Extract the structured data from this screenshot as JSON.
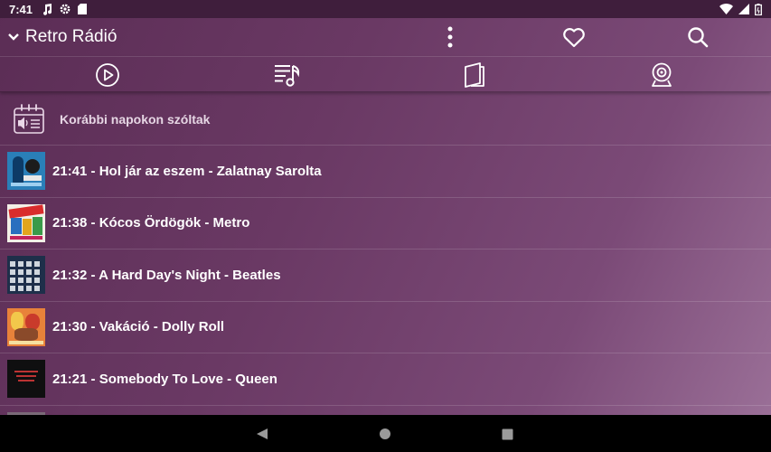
{
  "status_bar": {
    "time": "7:41",
    "left_icons": [
      "music-note-icon",
      "gear-icon",
      "sd-card-icon"
    ],
    "right_icons": [
      "wifi-icon",
      "signal-icon",
      "battery-icon"
    ]
  },
  "app_bar": {
    "station_name": "Retro Rádió",
    "actions": [
      "more-vert-icon",
      "heart-icon",
      "search-icon"
    ]
  },
  "tabs": [
    {
      "name": "play-tab",
      "icon": "play-circle-icon",
      "selected": false
    },
    {
      "name": "playlist-tab",
      "icon": "playlist-music-icon",
      "selected": true
    },
    {
      "name": "book-tab",
      "icon": "book-icon",
      "selected": false
    },
    {
      "name": "webcam-tab",
      "icon": "webcam-icon",
      "selected": false
    }
  ],
  "history": {
    "section_label": "Korábbi napokon szóltak",
    "items": [
      {
        "text": "21:41 - Hol jár az eszem - Zalatnay Sarolta",
        "cover": "blue-album-cover"
      },
      {
        "text": "21:38 - Kócos Ördögök - Metro",
        "cover": "colorful-album-cover"
      },
      {
        "text": "21:32 - A Hard Day's Night - Beatles",
        "cover": "grid-portraits-cover"
      },
      {
        "text": "21:30 - Vakáció - Dolly Roll",
        "cover": "orange-album-cover"
      },
      {
        "text": "21:21 - Somebody To Love - Queen",
        "cover": "dark-text-cover"
      }
    ]
  },
  "nav_bar": {
    "buttons": [
      "back-icon",
      "home-icon",
      "recents-icon"
    ]
  },
  "colors": {
    "status_bar": "#3f1e3c",
    "gradient_start": "#5b2d55",
    "gradient_end": "#9a6f97"
  }
}
